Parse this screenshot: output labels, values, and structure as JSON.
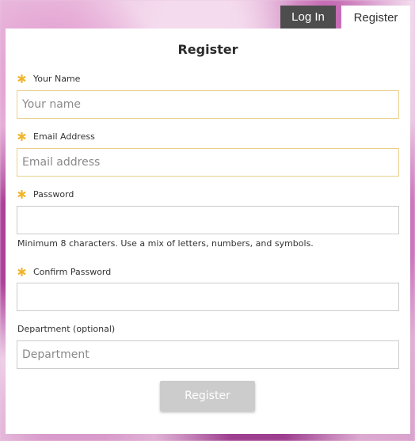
{
  "tabs": {
    "login_label": "Log In",
    "register_label": "Register"
  },
  "form": {
    "title": "Register",
    "fields": {
      "name": {
        "label": "Your Name",
        "placeholder": "Your name",
        "value": "",
        "required": true
      },
      "email": {
        "label": "Email Address",
        "placeholder": "Email address",
        "value": "",
        "required": true
      },
      "password": {
        "label": "Password",
        "placeholder": "",
        "value": "",
        "required": true,
        "hint": "Minimum 8 characters. Use a mix of letters, numbers, and symbols."
      },
      "confirm_password": {
        "label": "Confirm Password",
        "placeholder": "",
        "value": "",
        "required": true
      },
      "department": {
        "label": "Department (optional)",
        "placeholder": "Department",
        "value": "",
        "required": false
      }
    },
    "submit_label": "Register",
    "submit_enabled": false
  },
  "icons": {
    "required": "asterisk-icon"
  },
  "colors": {
    "required_marker": "#f0b42a",
    "active_tab_bg": "#ffffff",
    "inactive_tab_bg": "#4d4d4d",
    "submit_disabled_bg": "#cccccc"
  }
}
